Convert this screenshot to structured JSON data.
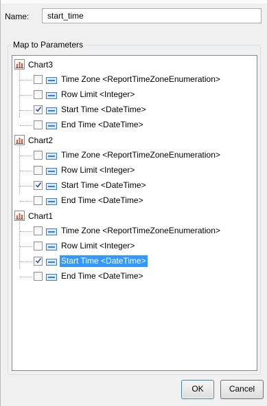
{
  "name_field": {
    "label": "Name:",
    "value": "start_time"
  },
  "group": {
    "legend": "Map to Parameters"
  },
  "tree": [
    {
      "chart": "Chart3",
      "params": [
        {
          "label": "Time Zone <ReportTimeZoneEnumeration>",
          "checked": false,
          "selected": false
        },
        {
          "label": "Row Limit <Integer>",
          "checked": false,
          "selected": false
        },
        {
          "label": "Start Time <DateTime>",
          "checked": true,
          "selected": false
        },
        {
          "label": "End Time <DateTime>",
          "checked": false,
          "selected": false
        }
      ]
    },
    {
      "chart": "Chart2",
      "params": [
        {
          "label": "Time Zone <ReportTimeZoneEnumeration>",
          "checked": false,
          "selected": false
        },
        {
          "label": "Row Limit <Integer>",
          "checked": false,
          "selected": false
        },
        {
          "label": "Start Time <DateTime>",
          "checked": true,
          "selected": false
        },
        {
          "label": "End Time <DateTime>",
          "checked": false,
          "selected": false
        }
      ]
    },
    {
      "chart": "Chart1",
      "params": [
        {
          "label": "Time Zone <ReportTimeZoneEnumeration>",
          "checked": false,
          "selected": false
        },
        {
          "label": "Row Limit <Integer>",
          "checked": false,
          "selected": false
        },
        {
          "label": "Start Time <DateTime>",
          "checked": true,
          "selected": true
        },
        {
          "label": "End Time <DateTime>",
          "checked": false,
          "selected": false
        }
      ]
    }
  ],
  "buttons": {
    "ok": "OK",
    "cancel": "Cancel"
  },
  "colors": {
    "selection": "#3399ff",
    "chart_icon_bars": "#e8542f",
    "param_icon": "#3a7fc4"
  }
}
